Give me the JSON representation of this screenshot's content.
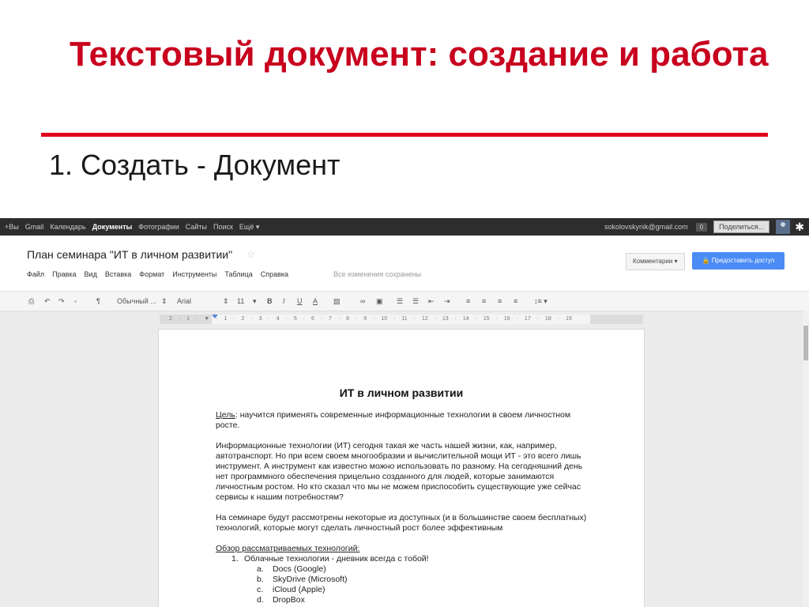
{
  "slide": {
    "title": "Текстовый документ: создание и работа",
    "step": "1. Создать - Документ"
  },
  "gbar": {
    "items": [
      "+Вы",
      "Gmail",
      "Календарь",
      "Документы",
      "Фотографии",
      "Сайты",
      "Поиск",
      "Ещё ▾"
    ],
    "active_index": 3,
    "email": "sokolovskynik@gmail.com",
    "count": "0",
    "share_label": "Поделиться...",
    "gear_icon": "gear-icon",
    "colors": {
      "bar": "#2d2d2d",
      "text": "#cccccc"
    }
  },
  "doc": {
    "title": "План семинара \"ИТ в личном развитии\"",
    "star_icon": "star-icon",
    "menu": [
      "Файл",
      "Правка",
      "Вид",
      "Вставка",
      "Формат",
      "Инструменты",
      "Таблица",
      "Справка"
    ],
    "saved_status": "Все изменения сохранены",
    "comments_label": "Комментарии ▾",
    "share_button_label": "🔒 Предоставить доступ",
    "colors": {
      "share_button": "#4a8bf5"
    }
  },
  "toolbar": {
    "style_select": "Обычный ...",
    "font_select": "Arial",
    "font_size": "11",
    "bold": "B",
    "italic": "I",
    "underline": "U",
    "text_color": "A",
    "line_spacing": "↕≡ ▾"
  },
  "ruler": {
    "numbers": "2 · 1 · ▼ · 1 · 2 · 3 · 4 · 5 · 6 · 7 · 8 · 9 · 10 · 11 · 12 · 13 · 14 · 15 · 16 · 17 · 18 · 19"
  },
  "page": {
    "heading": "ИТ в личном развитии",
    "goal_label": "Цель",
    "goal_text": ": научится применять современные информационные технологии в своем личностном росте.",
    "para1": "Информационные технологии (ИТ) сегодня такая же часть нашей жизни, как, например, автотранспорт. Но при всем своем многообразии и вычислительной мощи ИТ - это всего лишь инструмент. А инструмент как известно можно использовать по разному. На сегодняшний день нет программного обеспечения прицельно созданного для людей, которые занимаются личностным ростом. Но кто сказал что мы не можем приспособить существующие уже сейчас сервисы к нашим потребностям?",
    "para2": "На семинаре будут рассмотрены некоторые из доступных (и в большинстве своем бесплатных) технологий, которые могут сделать личностный рост более эффективным",
    "overview_label": "Обзор рассматриваемых технологий:",
    "list1": [
      {
        "num": "1.",
        "text": "Облачные технологии - дневник всегда с тобой!"
      }
    ],
    "list2": [
      {
        "num": "a.",
        "text": "Docs (Google)"
      },
      {
        "num": "b.",
        "text": "SkyDrive (Microsoft)"
      },
      {
        "num": "c.",
        "text": "iCloud (Apple)"
      },
      {
        "num": "d.",
        "text": "DropBox"
      }
    ]
  }
}
